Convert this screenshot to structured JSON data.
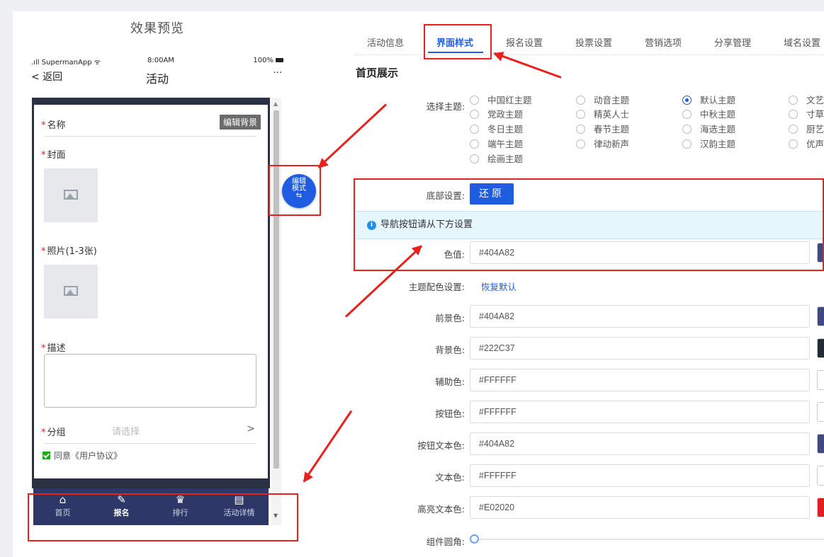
{
  "preview": {
    "title": "效果预览",
    "status": {
      "carrier": ".ıll SupermanApp ᯤ",
      "time": "8:00AM",
      "battery": "100%"
    },
    "nav": {
      "back": "< 返回",
      "title": "活动",
      "more": "···"
    },
    "form": {
      "name_label": "名称",
      "edit_bg": "编辑背景",
      "cover_label": "封面",
      "photo_label": "照片(1-3张)",
      "desc_label": "描述",
      "group_label": "分组",
      "group_placeholder": "请选择",
      "agree_text": "同意《用户协议》"
    },
    "float_button": {
      "line1": "编辑",
      "line2": "模式",
      "line3": "⇆"
    },
    "tabbar": [
      {
        "icon": "home-icon",
        "glyph": "⌂",
        "label": "首页"
      },
      {
        "icon": "brush-icon",
        "glyph": "✎",
        "label": "报名"
      },
      {
        "icon": "trophy-icon",
        "glyph": "♛",
        "label": "排行"
      },
      {
        "icon": "document-icon",
        "glyph": "▤",
        "label": "活动详情"
      }
    ]
  },
  "tabs": [
    "活动信息",
    "界面样式",
    "报名设置",
    "投票设置",
    "营销选项",
    "分享管理",
    "域名设置"
  ],
  "active_tab": "界面样式",
  "section_title": "首页展示",
  "theme": {
    "label": "选择主题:",
    "options": [
      [
        "中国红主题",
        "党政主题",
        "冬日主题",
        "端午主题",
        "绘画主题"
      ],
      [
        "动音主题",
        "精英人士",
        "春节主题",
        "律动新声"
      ],
      [
        "默认主题",
        "中秋主题",
        "海选主题",
        "汉韵主题"
      ],
      [
        "文艺",
        "寸草",
        "厨艺",
        "优声"
      ]
    ],
    "selected": "默认主题"
  },
  "bottom": {
    "label": "底部设置:",
    "restore": "还原"
  },
  "info": "导航按钮请从下方设置",
  "nav_color": {
    "label": "色值:",
    "value": "#404A82"
  },
  "scheme": {
    "label": "主题配色设置:",
    "reset_link": "恢复默认"
  },
  "colors": [
    {
      "label": "前景色:",
      "value": "#404A82",
      "swatch": "#404A82"
    },
    {
      "label": "背景色:",
      "value": "#222C37",
      "swatch": "#222C37"
    },
    {
      "label": "辅助色:",
      "value": "#FFFFFF",
      "swatch": "#FFFFFF"
    },
    {
      "label": "按钮色:",
      "value": "#FFFFFF",
      "swatch": "#FFFFFF"
    },
    {
      "label": "按钮文本色:",
      "value": "#404A82",
      "swatch": "#404A82"
    },
    {
      "label": "文本色:",
      "value": "#FFFFFF",
      "swatch": "#FFFFFF"
    },
    {
      "label": "高亮文本色:",
      "value": "#E02020",
      "swatch": "#E02020"
    }
  ],
  "corner": {
    "label": "组件圆角:",
    "value": 0
  },
  "accent_color": "#1F5DE0",
  "annotation_color": "#E8211F"
}
